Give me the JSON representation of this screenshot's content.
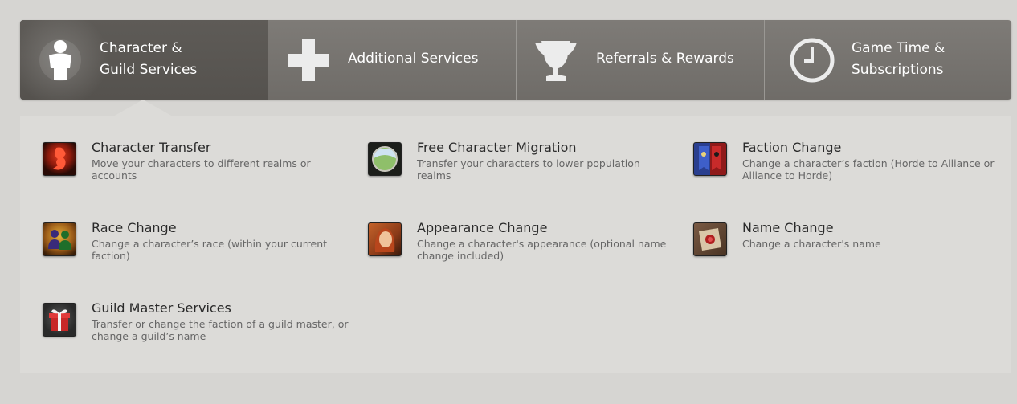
{
  "nav": {
    "tabs": [
      {
        "line1": "Character &",
        "line2": "Guild Services",
        "icon": "character-icon",
        "active": true
      },
      {
        "label": "Additional Services",
        "icon": "plus-icon",
        "active": false
      },
      {
        "label": "Referrals & Rewards",
        "icon": "trophy-icon",
        "active": false
      },
      {
        "line1": "Game Time &",
        "line2": "Subscriptions",
        "icon": "clock-icon",
        "active": false
      }
    ]
  },
  "services": [
    {
      "title": "Character Transfer",
      "desc": "Move your characters to different realms or accounts",
      "icon": "character-transfer-icon"
    },
    {
      "title": "Free Character Migration",
      "desc": "Transfer your characters to lower population realms",
      "icon": "globe-icon"
    },
    {
      "title": "Faction Change",
      "desc": "Change a character’s faction (Horde to Alliance or Alliance to Horde)",
      "icon": "faction-banner-icon"
    },
    {
      "title": "Race Change",
      "desc": "Change a character’s race (within your current faction)",
      "icon": "race-silhouettes-icon"
    },
    {
      "title": "Appearance Change",
      "desc": "Change a character's appearance (optional name change included)",
      "icon": "portrait-icon"
    },
    {
      "title": "Name Change",
      "desc": "Change a character's name",
      "icon": "scroll-seal-icon"
    },
    {
      "title": "Guild Master Services",
      "desc": "Transfer or change the faction of a guild master, or change a guild’s name",
      "icon": "gift-box-icon"
    }
  ],
  "colors": {
    "nav_bg": "#76736f",
    "nav_active": "#5a5753",
    "panel_bg": "#dcdbd8",
    "page_bg": "#d6d5d2"
  }
}
